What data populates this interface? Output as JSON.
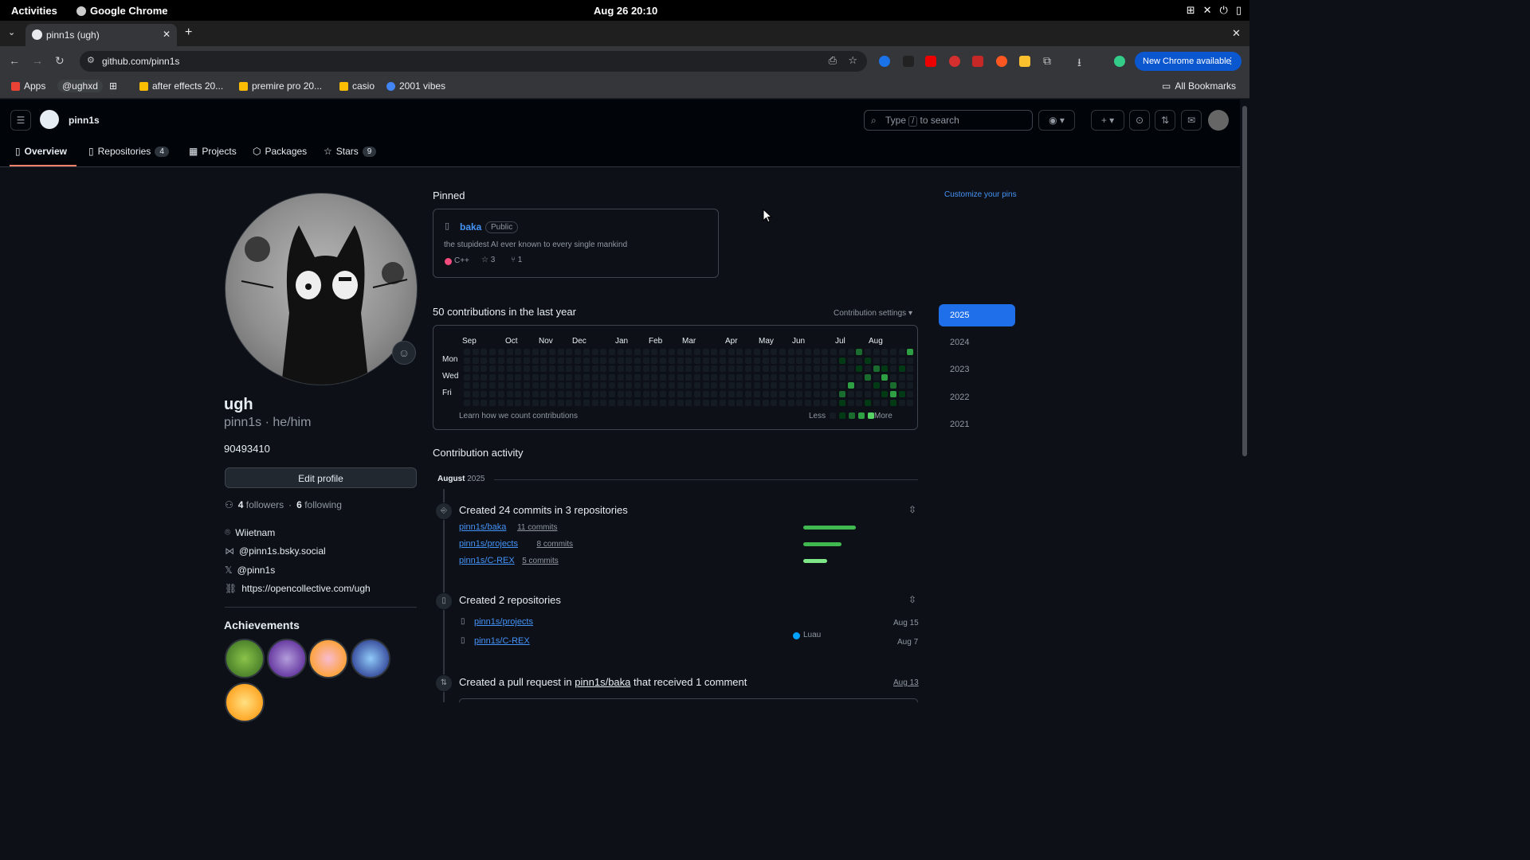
{
  "os_bar": {
    "activities": "Activities",
    "app": "Google Chrome",
    "clock": "Aug 26  20:10"
  },
  "browser": {
    "tab_title": "pinn1s (ugh)",
    "url": "github.com/pinn1s",
    "new_chrome": "New Chrome available",
    "bookmarks": [
      "Apps",
      "@ughxd",
      "after effects 20...",
      "premire pro 20...",
      "casio",
      "2001 vibes"
    ],
    "all_bookmarks": "All Bookmarks"
  },
  "gh": {
    "username": "pinn1s",
    "search_prefix": "Type",
    "search_key": "/",
    "search_suffix": "to search",
    "tabs": [
      {
        "label": "Overview",
        "count": ""
      },
      {
        "label": "Repositories",
        "count": "4"
      },
      {
        "label": "Projects",
        "count": ""
      },
      {
        "label": "Packages",
        "count": ""
      },
      {
        "label": "Stars",
        "count": "9"
      }
    ]
  },
  "profile": {
    "name": "ugh",
    "login_pronouns": "pinn1s · he/him",
    "bio": "90493410",
    "edit": "Edit profile",
    "followers_count": "4",
    "followers_label": "followers",
    "sep": "·",
    "following_count": "6",
    "following_label": "following",
    "location": "Wiietnam",
    "bluesky": "@pinn1s.bsky.social",
    "x": "@pinn1s",
    "website": "https://opencollective.com/ugh",
    "achievements": "Achievements"
  },
  "pinned": {
    "heading": "Pinned",
    "customize": "Customize your pins",
    "repo": "baka",
    "visibility": "Public",
    "description": "the stupidest AI ever known to every single mankind",
    "language": "C++",
    "language_color": "#f34b7d",
    "stars": "3",
    "forks": "1"
  },
  "contrib": {
    "heading": "50 contributions in the last year",
    "settings": "Contribution settings",
    "months": [
      "Sep",
      "Oct",
      "Nov",
      "Dec",
      "Jan",
      "Feb",
      "Mar",
      "Apr",
      "May",
      "Jun",
      "Jul",
      "Aug"
    ],
    "days": [
      "Mon",
      "Wed",
      "Fri"
    ],
    "learn": "Learn how we count contributions",
    "less": "Less",
    "more": "More",
    "years": [
      "2025",
      "2024",
      "2023",
      "2022",
      "2021"
    ],
    "active_cells": [
      [
        48,
        1,
        1
      ],
      [
        48,
        5,
        2
      ],
      [
        48,
        6,
        1
      ],
      [
        49,
        4,
        3
      ],
      [
        50,
        0,
        2
      ],
      [
        50,
        2,
        1
      ],
      [
        51,
        1,
        1
      ],
      [
        51,
        3,
        2
      ],
      [
        51,
        6,
        1
      ],
      [
        52,
        2,
        2
      ],
      [
        52,
        4,
        1
      ],
      [
        53,
        2,
        1
      ],
      [
        53,
        3,
        3
      ],
      [
        53,
        5,
        1
      ],
      [
        54,
        4,
        2
      ],
      [
        54,
        5,
        3
      ],
      [
        54,
        6,
        1
      ],
      [
        55,
        2,
        1
      ],
      [
        55,
        5,
        1
      ],
      [
        56,
        0,
        3
      ]
    ]
  },
  "activity": {
    "heading": "Contribution activity",
    "month": "August",
    "year": "2025",
    "commits_title": "Created 24 commits in 3 repositories",
    "commit_rows": [
      {
        "repo": "pinn1s/baka",
        "commits": "11 commits",
        "fraction": 1.0
      },
      {
        "repo": "pinn1s/projects",
        "commits": "8 commits",
        "fraction": 0.73
      },
      {
        "repo": "pinn1s/C-REX",
        "commits": "5 commits",
        "fraction": 0.45
      }
    ],
    "repos_title": "Created 2 repositories",
    "repo_rows": [
      {
        "name": "pinn1s/projects",
        "lang": "",
        "date": "Aug 15"
      },
      {
        "name": "pinn1s/C-REX",
        "lang": "Luau",
        "date": "Aug 7"
      }
    ],
    "lang_color": "#00a2ff",
    "pr_prefix": "Created a pull request in",
    "pr_repo": "pinn1s/baka",
    "pr_suffix": "that received 1 comment",
    "pr_date": "Aug 13"
  }
}
